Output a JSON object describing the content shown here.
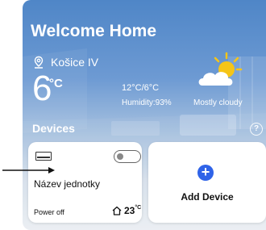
{
  "header": {
    "title": "Welcome Home"
  },
  "weather": {
    "location": "Košice IV",
    "temperature": "6",
    "unit": "°C",
    "minmax": "12°C/6°C",
    "humidity": "Humidity:93%",
    "condition": "Mostly cloudy",
    "icon": "partly-cloudy-sun-icon"
  },
  "devices": {
    "title": "Devices",
    "help_icon": "question-circle-icon",
    "items": [
      {
        "icon": "ac-unit-icon",
        "name": "Název jednotky",
        "status": "Power off",
        "temperature": "23",
        "temp_unit": "°C",
        "power_on": false
      }
    ],
    "add": {
      "label": "Add Device",
      "icon": "plus-circle-icon"
    }
  },
  "colors": {
    "accent": "#2f63e8",
    "sky_top": "#4f86c7",
    "sun": "#f5c518"
  }
}
